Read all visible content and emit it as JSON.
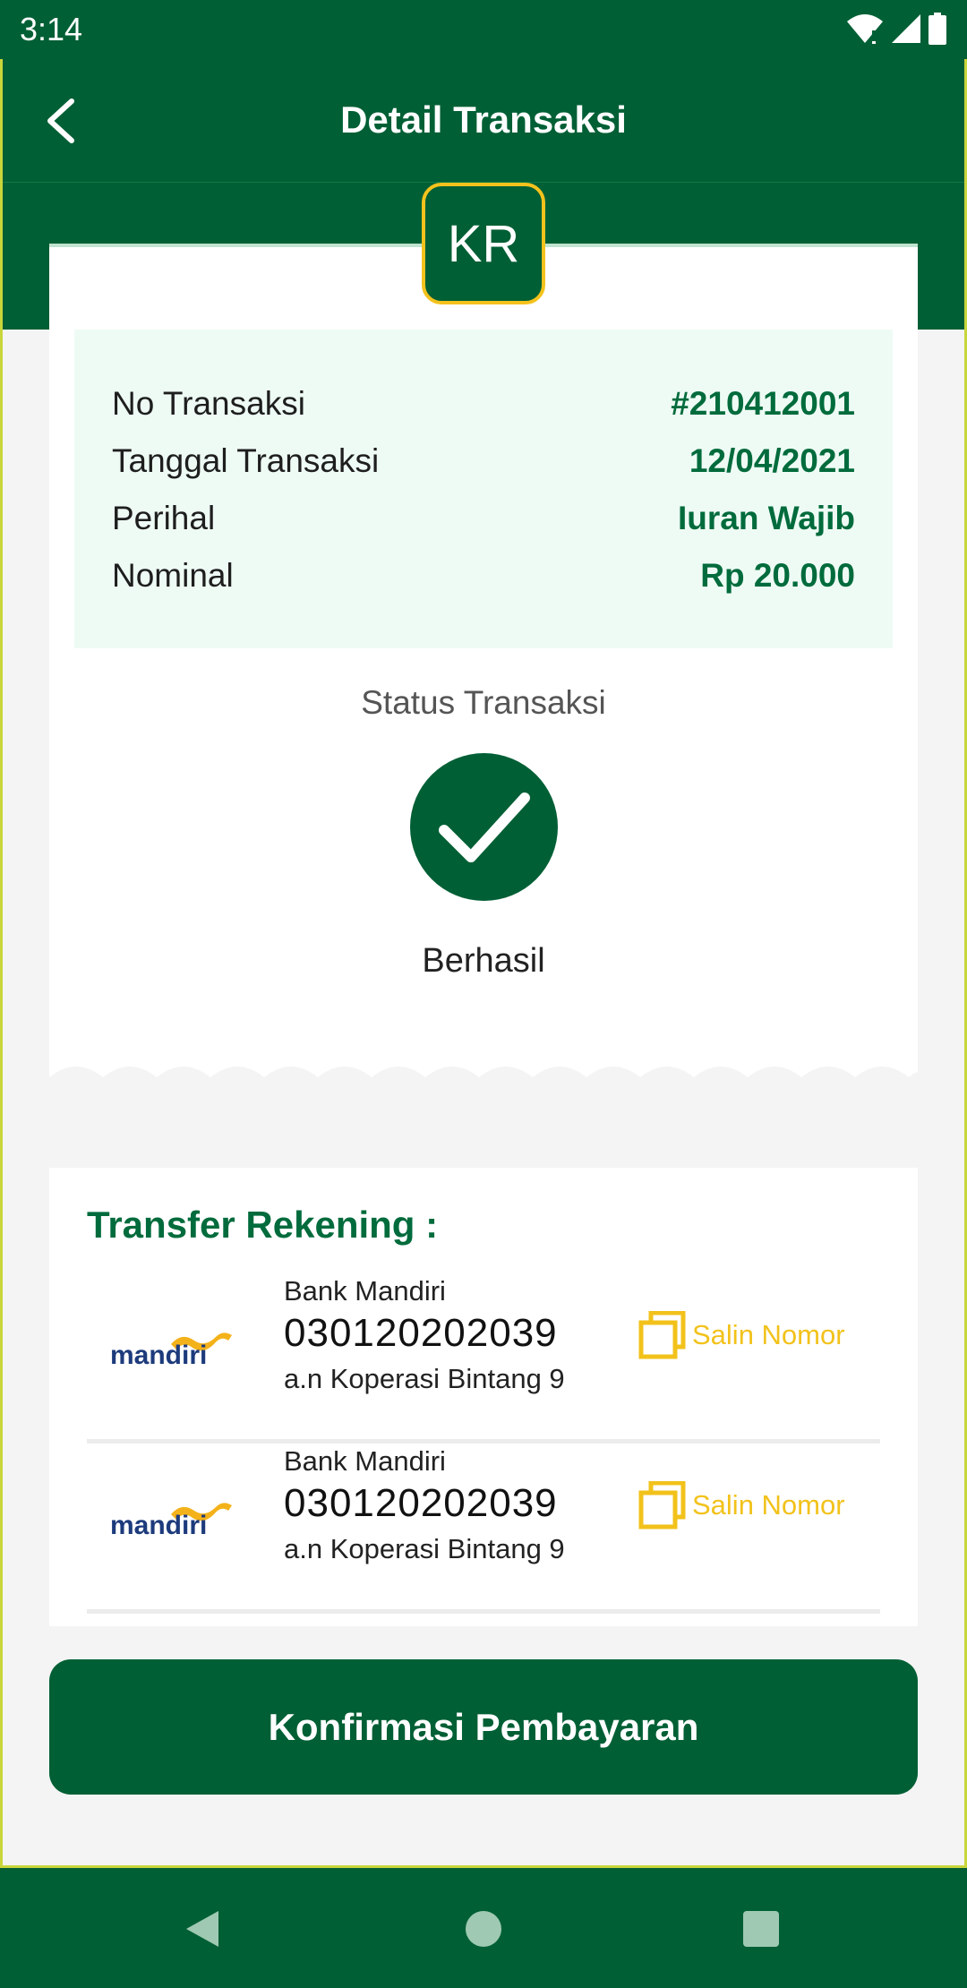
{
  "status_bar": {
    "time": "3:14"
  },
  "app_bar": {
    "title": "Detail Transaksi"
  },
  "badge": {
    "initials": "KR"
  },
  "transaction": {
    "rows": [
      {
        "label": "No Transaksi",
        "value": "#210412001"
      },
      {
        "label": "Tanggal Transaksi",
        "value": "12/04/2021"
      },
      {
        "label": "Perihal",
        "value": "Iuran Wajib"
      },
      {
        "label": "Nominal",
        "value": "Rp 20.000"
      }
    ],
    "status_label": "Status Transaksi",
    "status_value": "Berhasil"
  },
  "transfer": {
    "heading": "Transfer Rekening :",
    "accounts": [
      {
        "logo_text": "mandiri",
        "bank": "Bank Mandiri",
        "number": "030120202039",
        "owner": "a.n Koperasi Bintang 9",
        "copy_label": "Salin Nomor"
      },
      {
        "logo_text": "mandiri",
        "bank": "Bank Mandiri",
        "number": "030120202039",
        "owner": "a.n Koperasi Bintang 9",
        "copy_label": "Salin Nomor"
      }
    ]
  },
  "confirm_button": {
    "label": "Konfirmasi Pembayaran"
  },
  "colors": {
    "primary": "#005f35",
    "accent": "#f4c21c",
    "value_green": "#006b3c",
    "info_bg": "#eefbf4"
  },
  "icons": [
    "wifi-icon",
    "signal-icon",
    "battery-icon",
    "back-arrow-icon",
    "check-icon",
    "copy-icon",
    "nav-back-icon",
    "nav-home-icon",
    "nav-recents-icon"
  ]
}
